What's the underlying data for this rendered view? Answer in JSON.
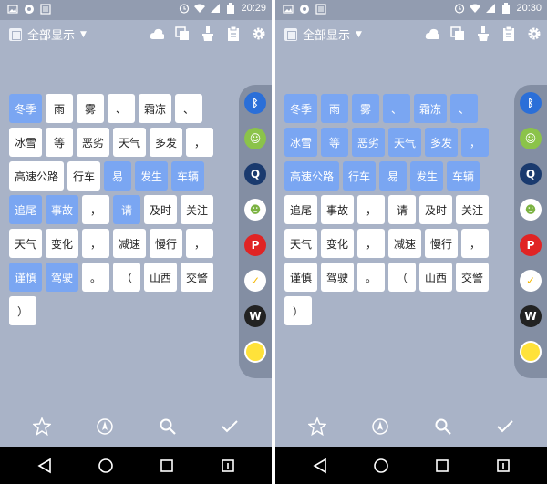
{
  "colors": {
    "background": "#a9b3c7",
    "statusbar": "#929cb0",
    "chip_white": "#ffffff",
    "chip_blue": "#7aa6f2",
    "sidebar": "#838ea3",
    "navbar": "#000000"
  },
  "status_icons": [
    "image-icon",
    "chat-bubble-icon",
    "app-icon",
    "alarm-icon",
    "wifi-icon",
    "signal-icon",
    "battery-icon"
  ],
  "toolbar_icons": [
    "cloud-icon",
    "copy-icon",
    "brush-icon",
    "clipboard-icon",
    "gear-icon"
  ],
  "sidebar_apps": [
    "bluetooth-app-icon",
    "android-green-app-icon",
    "search-app-icon",
    "android-white-app-icon",
    "pinterest-app-icon",
    "checkmark-app-icon",
    "w-app-icon",
    "sun-app-icon"
  ],
  "bottom_actions": [
    "star-icon",
    "compass-icon",
    "search-icon",
    "checkmark-icon"
  ],
  "nav_buttons": [
    "back-icon",
    "home-icon",
    "recents-icon",
    "menu-icon"
  ],
  "screens": [
    {
      "status": {
        "time": "20:29"
      },
      "filter_label": "全部显示",
      "rows": [
        [
          {
            "text": "冬季",
            "style": "blue"
          },
          {
            "text": "雨",
            "style": "white"
          },
          {
            "text": "雾",
            "style": "white"
          },
          {
            "text": "、",
            "style": "white"
          },
          {
            "text": "霜冻",
            "style": "white"
          },
          {
            "text": "、",
            "style": "white"
          }
        ],
        [
          {
            "text": "冰雪",
            "style": "white"
          },
          {
            "text": "等",
            "style": "white"
          },
          {
            "text": "恶劣",
            "style": "white"
          },
          {
            "text": "天气",
            "style": "white"
          },
          {
            "text": "多发",
            "style": "white"
          },
          {
            "text": "，",
            "style": "white"
          }
        ],
        [
          {
            "text": "高速公路",
            "style": "white"
          },
          {
            "text": "行车",
            "style": "white"
          },
          {
            "text": "易",
            "style": "blue"
          },
          {
            "text": "发生",
            "style": "blue"
          },
          {
            "text": "车辆",
            "style": "blue"
          }
        ],
        [
          {
            "text": "追尾",
            "style": "blue"
          },
          {
            "text": "事故",
            "style": "blue"
          },
          {
            "text": "，",
            "style": "white"
          },
          {
            "text": "请",
            "style": "blue"
          },
          {
            "text": "及时",
            "style": "white"
          },
          {
            "text": "关注",
            "style": "white"
          }
        ],
        [
          {
            "text": "天气",
            "style": "white"
          },
          {
            "text": "变化",
            "style": "white"
          },
          {
            "text": "，",
            "style": "white"
          },
          {
            "text": "减速",
            "style": "white"
          },
          {
            "text": "慢行",
            "style": "white"
          },
          {
            "text": "，",
            "style": "white"
          }
        ],
        [
          {
            "text": "谨慎",
            "style": "blue"
          },
          {
            "text": "驾驶",
            "style": "blue"
          },
          {
            "text": "。",
            "style": "white"
          },
          {
            "text": "（",
            "style": "white"
          },
          {
            "text": "山西",
            "style": "white"
          },
          {
            "text": "交警",
            "style": "white"
          }
        ],
        [
          {
            "text": "）",
            "style": "white"
          }
        ]
      ]
    },
    {
      "status": {
        "time": "20:30"
      },
      "filter_label": "全部显示",
      "rows": [
        [
          {
            "text": "冬季",
            "style": "blue"
          },
          {
            "text": "雨",
            "style": "blue"
          },
          {
            "text": "雾",
            "style": "blue"
          },
          {
            "text": "、",
            "style": "blue"
          },
          {
            "text": "霜冻",
            "style": "blue"
          },
          {
            "text": "、",
            "style": "blue"
          }
        ],
        [
          {
            "text": "冰雪",
            "style": "blue"
          },
          {
            "text": "等",
            "style": "blue"
          },
          {
            "text": "恶劣",
            "style": "blue"
          },
          {
            "text": "天气",
            "style": "blue"
          },
          {
            "text": "多发",
            "style": "blue"
          },
          {
            "text": "，",
            "style": "blue"
          }
        ],
        [
          {
            "text": "高速公路",
            "style": "blue"
          },
          {
            "text": "行车",
            "style": "blue"
          },
          {
            "text": "易",
            "style": "blue"
          },
          {
            "text": "发生",
            "style": "blue"
          },
          {
            "text": "车辆",
            "style": "blue"
          }
        ],
        [
          {
            "text": "追尾",
            "style": "white"
          },
          {
            "text": "事故",
            "style": "white"
          },
          {
            "text": "，",
            "style": "white"
          },
          {
            "text": "请",
            "style": "white"
          },
          {
            "text": "及时",
            "style": "white"
          },
          {
            "text": "关注",
            "style": "white"
          }
        ],
        [
          {
            "text": "天气",
            "style": "white"
          },
          {
            "text": "变化",
            "style": "white"
          },
          {
            "text": "，",
            "style": "white"
          },
          {
            "text": "减速",
            "style": "white"
          },
          {
            "text": "慢行",
            "style": "white"
          },
          {
            "text": "，",
            "style": "white"
          }
        ],
        [
          {
            "text": "谨慎",
            "style": "white"
          },
          {
            "text": "驾驶",
            "style": "white"
          },
          {
            "text": "。",
            "style": "white"
          },
          {
            "text": "（",
            "style": "white"
          },
          {
            "text": "山西",
            "style": "white"
          },
          {
            "text": "交警",
            "style": "white"
          }
        ],
        [
          {
            "text": "）",
            "style": "white"
          }
        ]
      ]
    }
  ]
}
